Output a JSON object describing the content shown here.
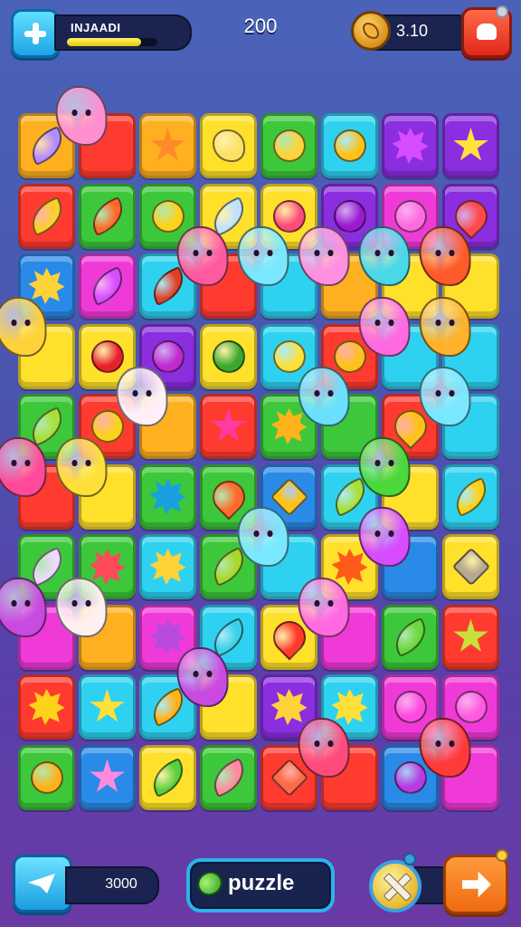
{
  "hud": {
    "player_name": "INJAADI",
    "xp_progress": 0.82,
    "score": "200",
    "coins": "3.10"
  },
  "footer": {
    "currency": "3000",
    "mode_label": "puzzle"
  },
  "board": {
    "rows": 10,
    "cols": 8,
    "cells": [
      [
        "orange",
        "leaf",
        "#b58cff"
      ],
      [
        "red",
        "face",
        "#ff8fd0"
      ],
      [
        "orange",
        "star",
        "#ff8a2a"
      ],
      [
        "yellow",
        "blob",
        "#ffe066"
      ],
      [
        "green",
        "round",
        "#ffd23a"
      ],
      [
        "cyan",
        "round",
        "#ffc21a"
      ],
      [
        "purple",
        "splat",
        "#d84cff"
      ],
      [
        "purple",
        "star",
        "#ffe23a"
      ],
      [
        "red",
        "leaf",
        "#ffd02a"
      ],
      [
        "green",
        "leaf",
        "#ff6a2a"
      ],
      [
        "green",
        "round",
        "#ffd21a"
      ],
      [
        "yellow",
        "leaf",
        "#bfe2ff"
      ],
      [
        "yellow",
        "round",
        "#ff4a7a"
      ],
      [
        "purple",
        "round",
        "#9a1ad0"
      ],
      [
        "magenta",
        "round",
        "#ff6ae0"
      ],
      [
        "purple",
        "drop",
        "#ff4a4a"
      ],
      [
        "blue",
        "splat",
        "#ffd23a"
      ],
      [
        "magenta",
        "leaf",
        "#d84cff"
      ],
      [
        "cyan",
        "leaf",
        "#e0402a"
      ],
      [
        "red",
        "face",
        "#ff5aa0"
      ],
      [
        "cyan",
        "face",
        "#7ae8ff"
      ],
      [
        "orange",
        "face",
        "#ff8fe0"
      ],
      [
        "yellow",
        "face",
        "#4ad8e8"
      ],
      [
        "yellow",
        "face",
        "#ff5a2a"
      ],
      [
        "yellow",
        "face",
        "#ffd23a"
      ],
      [
        "yellow",
        "round",
        "#e8202a"
      ],
      [
        "purple",
        "round",
        "#c02ad0"
      ],
      [
        "yellow",
        "round",
        "#3aa82a"
      ],
      [
        "cyan",
        "round",
        "#ffe03a"
      ],
      [
        "red",
        "round",
        "#ffc21a"
      ],
      [
        "cyan",
        "face",
        "#ff6ae0"
      ],
      [
        "cyan",
        "face",
        "#ffb22a"
      ],
      [
        "green",
        "leaf",
        "#a8e03a"
      ],
      [
        "red",
        "round",
        "#ffd21a"
      ],
      [
        "orange",
        "face",
        "#fff0f8"
      ],
      [
        "red",
        "star",
        "#ff3aa0"
      ],
      [
        "green",
        "splat",
        "#ffb21a"
      ],
      [
        "green",
        "face",
        "#6ae0ff"
      ],
      [
        "red",
        "drop",
        "#ffc21a"
      ],
      [
        "cyan",
        "face",
        "#7ae8ff"
      ],
      [
        "red",
        "face",
        "#ff4a9a"
      ],
      [
        "yellow",
        "face",
        "#ffe03a"
      ],
      [
        "green",
        "splat",
        "#1aa0e0"
      ],
      [
        "green",
        "drop",
        "#ff6a2a"
      ],
      [
        "blue",
        "gem",
        "#ffc21a"
      ],
      [
        "cyan",
        "leaf",
        "#a8e03a"
      ],
      [
        "yellow",
        "face",
        "#4ad83a"
      ],
      [
        "cyan",
        "leaf",
        "#ffd21a"
      ],
      [
        "green",
        "leaf",
        "#f0d8ff"
      ],
      [
        "green",
        "splat",
        "#ff4a5a"
      ],
      [
        "cyan",
        "splat",
        "#ffd23a"
      ],
      [
        "green",
        "leaf",
        "#a8d82a"
      ],
      [
        "cyan",
        "face",
        "#7ae8ff"
      ],
      [
        "yellow",
        "splat",
        "#ff5a1a"
      ],
      [
        "blue",
        "face",
        "#d84cff"
      ],
      [
        "yellow",
        "gem",
        "#b8a890"
      ],
      [
        "magenta",
        "face",
        "#c84ae0"
      ],
      [
        "orange",
        "face",
        "#fff0f0"
      ],
      [
        "magenta",
        "splat",
        "#b84ae0"
      ],
      [
        "cyan",
        "leaf",
        "#3ad0e8"
      ],
      [
        "yellow",
        "drop",
        "#ff3a2a"
      ],
      [
        "magenta",
        "face",
        "#ff6ae0"
      ],
      [
        "green",
        "leaf",
        "#6ad83a"
      ],
      [
        "red",
        "star",
        "#c8e03a"
      ],
      [
        "red",
        "splat",
        "#ffd21a"
      ],
      [
        "cyan",
        "star",
        "#ffe03a"
      ],
      [
        "cyan",
        "leaf",
        "#ffb21a"
      ],
      [
        "yellow",
        "face",
        "#c84ae0"
      ],
      [
        "purple",
        "splat",
        "#ffd23a"
      ],
      [
        "cyan",
        "splat",
        "#ffe03a"
      ],
      [
        "magenta",
        "round",
        "#ff4ae0"
      ],
      [
        "magenta",
        "round",
        "#ff5ae0"
      ],
      [
        "green",
        "round",
        "#ffb21a"
      ],
      [
        "blue",
        "star",
        "#ff8ae0"
      ],
      [
        "yellow",
        "leaf",
        "#5ad03a"
      ],
      [
        "green",
        "leaf",
        "#ff8aa0"
      ],
      [
        "red",
        "gem",
        "#ff6a4a"
      ],
      [
        "red",
        "face",
        "#ff4a7a"
      ],
      [
        "blue",
        "round",
        "#b83ae0"
      ],
      [
        "magenta",
        "face",
        "#ff3a3a"
      ]
    ]
  },
  "colors": {
    "red": "#ff3b30",
    "orange": "#ffb020",
    "yellow": "#ffe02a",
    "green": "#3cc83a",
    "cyan": "#2ed2f0",
    "blue": "#2a8ae8",
    "purple": "#8a2ee0",
    "magenta": "#f03ad8"
  }
}
